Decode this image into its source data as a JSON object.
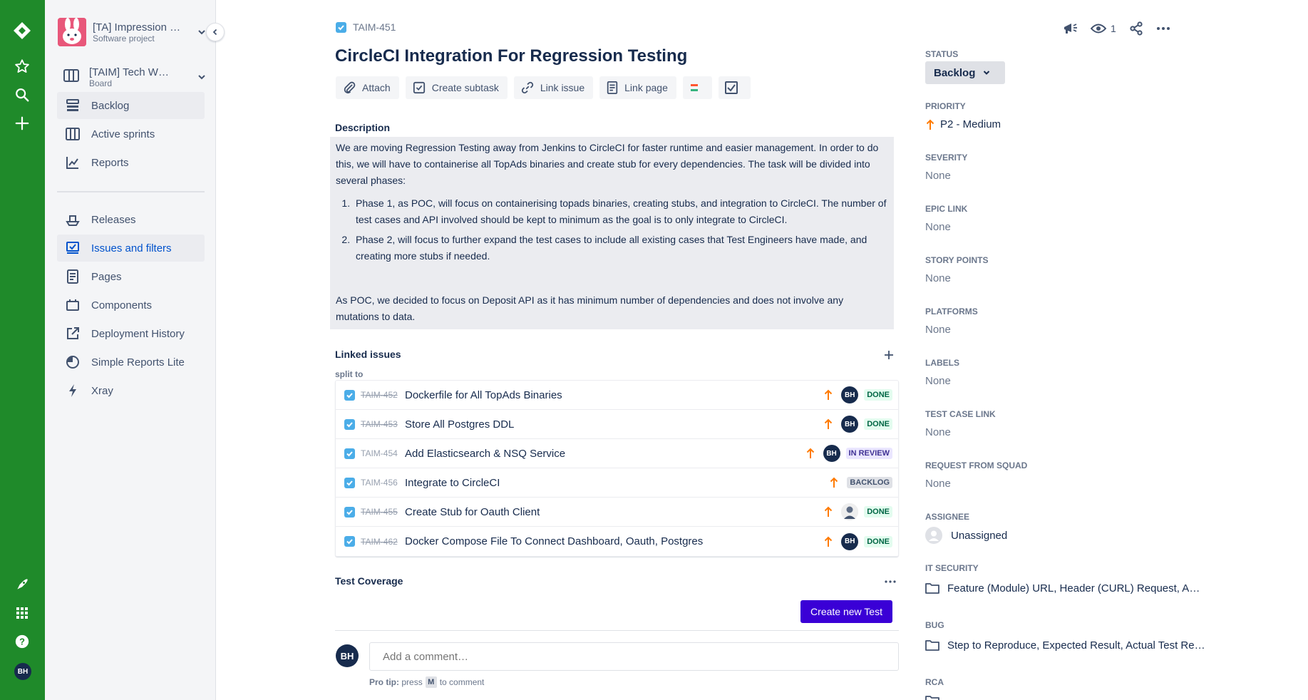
{
  "colors": {
    "rail": "#1f8a2a",
    "primary": "#3a00d6",
    "link_blue": "#0052cc",
    "priority_orange": "#ff7a00"
  },
  "sidebar": {
    "project_name": "[TA] Impression …",
    "project_type": "Software project",
    "board_name": "[TAIM] Tech W…",
    "board_type": "Board",
    "items": [
      {
        "label": "Backlog",
        "icon": "backlog-icon"
      },
      {
        "label": "Active sprints",
        "icon": "board-icon"
      },
      {
        "label": "Reports",
        "icon": "reports-icon"
      },
      {
        "label": "Releases",
        "icon": "ship-icon"
      },
      {
        "label": "Issues and filters",
        "icon": "issues-icon"
      },
      {
        "label": "Pages",
        "icon": "page-icon"
      },
      {
        "label": "Components",
        "icon": "components-icon"
      },
      {
        "label": "Deployment History",
        "icon": "external-link-icon"
      },
      {
        "label": "Simple Reports Lite",
        "icon": "pie-chart-icon"
      },
      {
        "label": "Xray",
        "icon": "lightning-icon"
      }
    ]
  },
  "rail": {
    "avatar": "BH"
  },
  "issue": {
    "key": "TAIM-451",
    "title": "CircleCI Integration For Regression Testing",
    "watchers": "1",
    "toolbar": {
      "attach": "Attach",
      "subtask": "Create subtask",
      "link_issue": "Link issue",
      "link_page": "Link page"
    },
    "description_label": "Description",
    "description": {
      "intro": "We are moving Regression Testing away from Jenkins to CircleCI for faster runtime and easier management. In order to do this, we will have to containerise all TopAds binaries and create stub for every dependencies. The task will be divided into several phases:",
      "phases": [
        "Phase 1, as POC, will focus on containerising topads binaries, creating stubs, and integration to CircleCI. The number of test cases and API involved should be kept to minimum as the goal is to only integrate to CircleCI.",
        "Phase 2, will focus to further expand the test cases to include all existing cases that Test Engineers have made, and creating more stubs if needed."
      ],
      "outro": "As POC, we decided to focus on Deposit API as it has minimum number of dependencies and does not involve any mutations to data."
    },
    "linked_label": "Linked issues",
    "linked_sub": "split to",
    "linked": [
      {
        "key": "TAIM-452",
        "summary": "Dockerfile for All TopAds Binaries",
        "avatar": "BH",
        "status": "DONE"
      },
      {
        "key": "TAIM-453",
        "summary": "Store All Postgres DDL",
        "avatar": "BH",
        "status": "DONE"
      },
      {
        "key": "TAIM-454",
        "summary": "Add Elasticsearch & NSQ Service",
        "avatar": "BH",
        "status": "IN REVIEW"
      },
      {
        "key": "TAIM-456",
        "summary": "Integrate to CircleCI",
        "avatar": "",
        "status": "BACKLOG"
      },
      {
        "key": "TAIM-455",
        "summary": "Create Stub for Oauth Client",
        "avatar": "",
        "status": "DONE"
      },
      {
        "key": "TAIM-462",
        "summary": "Docker Compose File To Connect Dashboard, Oauth, Postgres",
        "avatar": "BH",
        "status": "DONE"
      }
    ],
    "test_coverage_label": "Test Coverage",
    "create_test": "Create new Test",
    "comment": {
      "avatar": "BH",
      "placeholder": "Add a comment…",
      "tip_prefix": "Pro tip:",
      "tip_press": "press",
      "tip_key": "M",
      "tip_suffix": "to comment"
    }
  },
  "fields": {
    "status_label": "STATUS",
    "status": "Backlog",
    "priority_label": "PRIORITY",
    "priority": "P2 - Medium",
    "severity_label": "SEVERITY",
    "severity": "None",
    "epic_label": "EPIC LINK",
    "epic": "None",
    "points_label": "STORY POINTS",
    "points": "None",
    "platforms_label": "PLATFORMS",
    "platforms": "None",
    "labels_label": "LABELS",
    "labels": "None",
    "tcl_label": "TEST CASE LINK",
    "tcl": "None",
    "rfs_label": "REQUEST FROM SQUAD",
    "rfs": "None",
    "assignee_label": "ASSIGNEE",
    "assignee": "Unassigned",
    "its_label": "IT SECURITY",
    "its": "Feature (Module) URL, Header (CURL) Request, API …",
    "bug_label": "BUG",
    "bug": "Step to Reproduce, Expected Result, Actual Test Re…",
    "rca_label": "RCA"
  }
}
